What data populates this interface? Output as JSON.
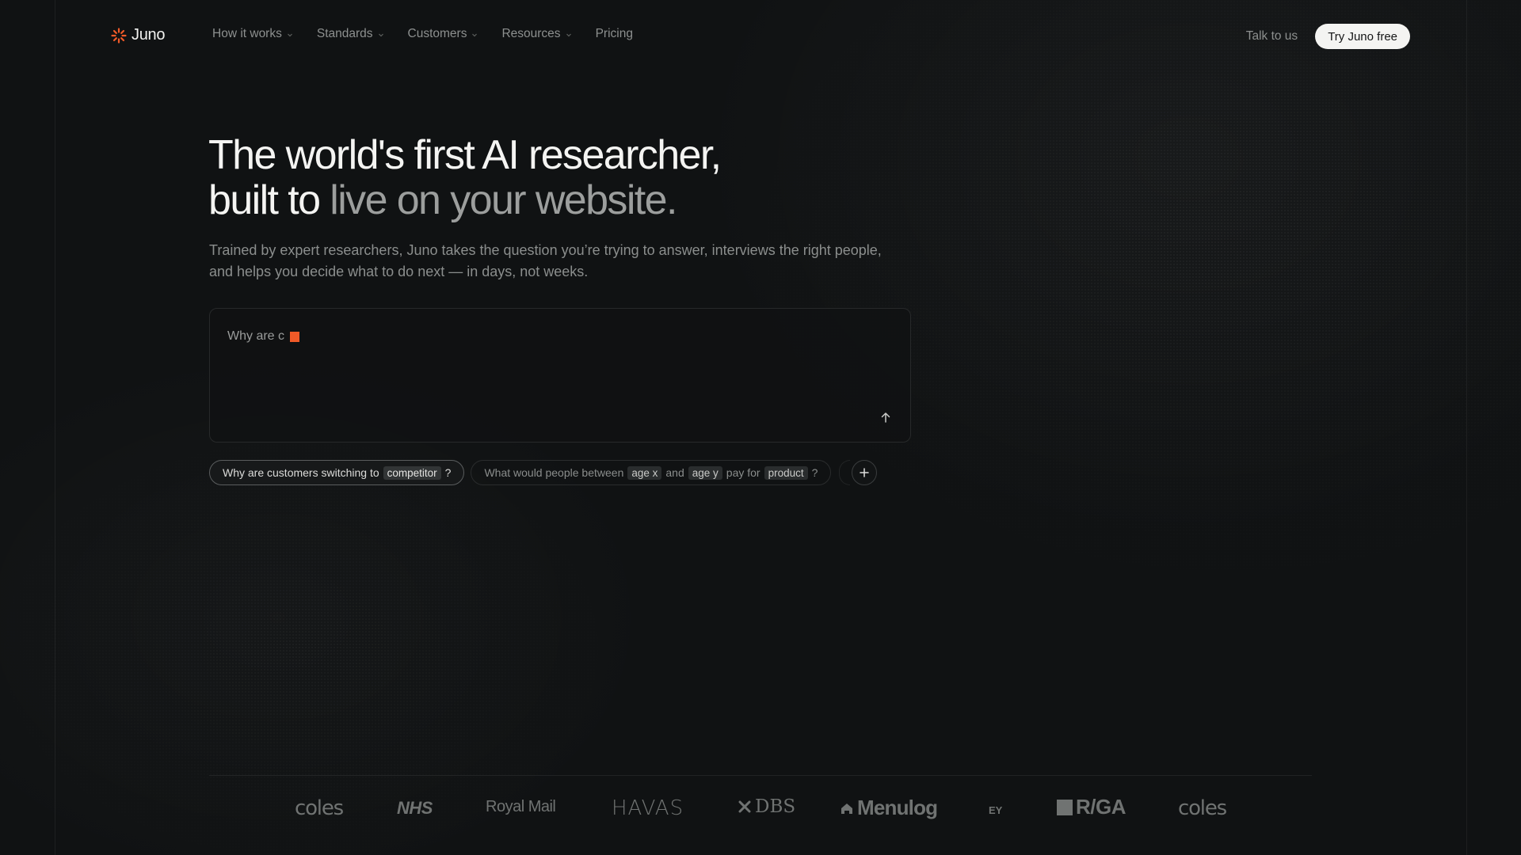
{
  "nav": {
    "brand": "Juno",
    "links": [
      {
        "label": "How it works",
        "has_dropdown": true
      },
      {
        "label": "Standards",
        "has_dropdown": true
      },
      {
        "label": "Customers",
        "has_dropdown": true
      },
      {
        "label": "Resources",
        "has_dropdown": true
      },
      {
        "label": "Pricing",
        "has_dropdown": false
      }
    ],
    "talk_label": "Talk to us",
    "cta_label": "Try Juno free"
  },
  "hero": {
    "title_line1": "The world's first AI researcher,",
    "title_line2_a": "built to ",
    "title_line2_b": "live on your website.",
    "subtitle": "Trained by expert researchers, Juno takes the question you’re trying to answer, interviews the right people, and helps you decide what to do next — in days, not weeks."
  },
  "prompt": {
    "typed_text": "Why are c",
    "send_icon": "arrow-up-icon"
  },
  "chips": [
    {
      "active": true,
      "parts": [
        {
          "text": "Why are customers switching to",
          "tag": false
        },
        {
          "text": "competitor",
          "tag": true
        },
        {
          "text": "?",
          "tag": false
        }
      ]
    },
    {
      "active": false,
      "parts": [
        {
          "text": "What would people between",
          "tag": false
        },
        {
          "text": "age x",
          "tag": true
        },
        {
          "text": "and",
          "tag": false
        },
        {
          "text": "age y",
          "tag": true
        },
        {
          "text": "pay for",
          "tag": false
        },
        {
          "text": "product",
          "tag": true
        },
        {
          "text": "?",
          "tag": false
        }
      ]
    }
  ],
  "more_chips_icon": "plus-icon",
  "logos": [
    "coles",
    "NHS",
    "Royal Mail",
    "HAVAS",
    "DBS",
    "Menulog",
    "EY",
    "R/GA",
    "coles"
  ],
  "colors": {
    "background": "#101213",
    "accent": "#f05a28",
    "cta_bg": "#f4f4f2"
  }
}
